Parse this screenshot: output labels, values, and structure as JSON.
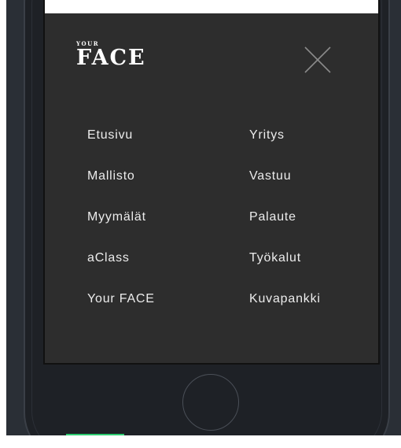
{
  "logo": {
    "small": "YOUR",
    "big": "FACE"
  },
  "close_button": {
    "icon": "close-icon"
  },
  "menu": {
    "left": [
      {
        "label": "Etusivu"
      },
      {
        "label": "Mallisto"
      },
      {
        "label": "Myymälät"
      },
      {
        "label": "aClass"
      },
      {
        "label": "Your FACE"
      }
    ],
    "right": [
      {
        "label": "Yritys"
      },
      {
        "label": "Vastuu"
      },
      {
        "label": "Palaute"
      },
      {
        "label": "Työkalut"
      },
      {
        "label": "Kuvapankki"
      }
    ]
  },
  "colors": {
    "screen_bg": "#2d2d2d",
    "phone_bg": "#1e2126",
    "menu_text": "#ececec",
    "accent": "#2ecc71"
  }
}
